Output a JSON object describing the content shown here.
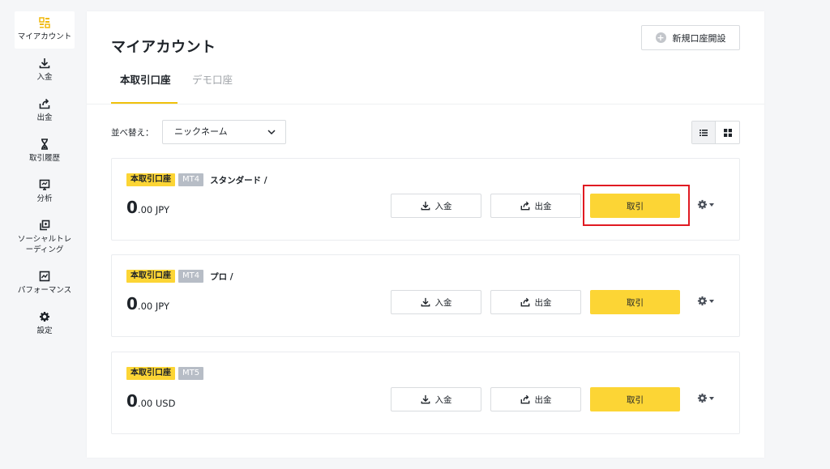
{
  "sidebar": {
    "items": [
      {
        "label": "マイアカウント",
        "icon": "dashboard-icon",
        "active": true
      },
      {
        "label": "入金",
        "icon": "download-icon"
      },
      {
        "label": "出金",
        "icon": "upload-icon"
      },
      {
        "label": "取引履歴",
        "icon": "hourglass-icon"
      },
      {
        "label": "分析",
        "icon": "analysis-icon"
      },
      {
        "label": "ソーシャルトレーディング",
        "icon": "copy-icon"
      },
      {
        "label": "パフォーマンス",
        "icon": "chart-icon"
      },
      {
        "label": "設定",
        "icon": "gear-icon"
      }
    ]
  },
  "header": {
    "title": "マイアカウント",
    "new_account_label": "新規口座開設"
  },
  "tabs": [
    {
      "label": "本取引口座",
      "active": true
    },
    {
      "label": "デモ口座",
      "active": false
    }
  ],
  "sort": {
    "label": "並べ替え：",
    "selected": "ニックネーム"
  },
  "accounts": [
    {
      "type": "本取引口座",
      "platform": "MT4",
      "name": "スタンダード /",
      "balance_int": "0",
      "balance_dec": ".00 JPY",
      "deposit": "入金",
      "withdraw": "出金",
      "trade": "取引"
    },
    {
      "type": "本取引口座",
      "platform": "MT4",
      "name": "プロ /",
      "balance_int": "0",
      "balance_dec": ".00 JPY",
      "deposit": "入金",
      "withdraw": "出金",
      "trade": "取引"
    },
    {
      "type": "本取引口座",
      "platform": "MT5",
      "name": "",
      "balance_int": "0",
      "balance_dec": ".00 USD",
      "deposit": "入金",
      "withdraw": "出金",
      "trade": "取引"
    }
  ],
  "colors": {
    "accent": "#fcd535",
    "highlight": "#e01a22"
  }
}
